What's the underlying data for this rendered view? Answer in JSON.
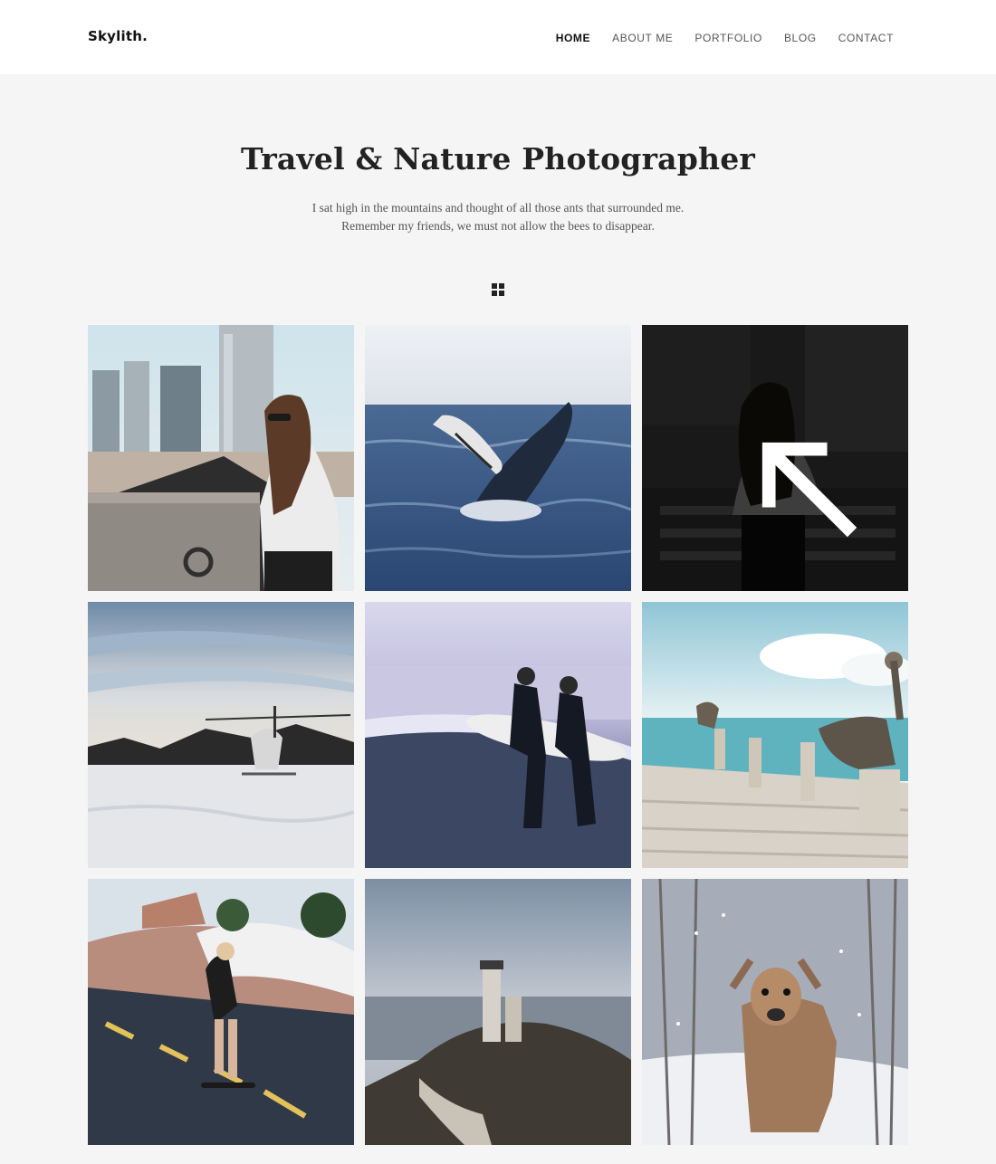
{
  "header": {
    "logo": "Skylith.",
    "nav": [
      {
        "label": "HOME",
        "active": true
      },
      {
        "label": "ABOUT ME",
        "active": false
      },
      {
        "label": "PORTFOLIO",
        "active": false
      },
      {
        "label": "BLOG",
        "active": false
      },
      {
        "label": "CONTACT",
        "active": false
      }
    ]
  },
  "hero": {
    "title": "Travel & Nature Photographer",
    "subtitle_line1": "I sat high in the mountains and thought of all those ants that surrounded me.",
    "subtitle_line2": "Remember my friends, we must not allow the bees to disappear."
  },
  "filter": {
    "icon": "grid-icon"
  },
  "gallery": {
    "items": [
      {
        "subject": "woman in sunglasses city rooftop"
      },
      {
        "subject": "humpback whale breaching"
      },
      {
        "subject": "woman walking street",
        "hovered": true,
        "overlay_icon": "expand-icon"
      },
      {
        "subject": "helicopter on snowy mountain"
      },
      {
        "subject": "two surfers on beach"
      },
      {
        "subject": "pelicans on pier"
      },
      {
        "subject": "girl longboarding on road"
      },
      {
        "subject": "lighthouse on rocky coast"
      },
      {
        "subject": "deer in snowy forest"
      }
    ]
  },
  "colors": {
    "background": "#f5f5f5",
    "header_bg": "#ffffff",
    "text": "#222222"
  }
}
